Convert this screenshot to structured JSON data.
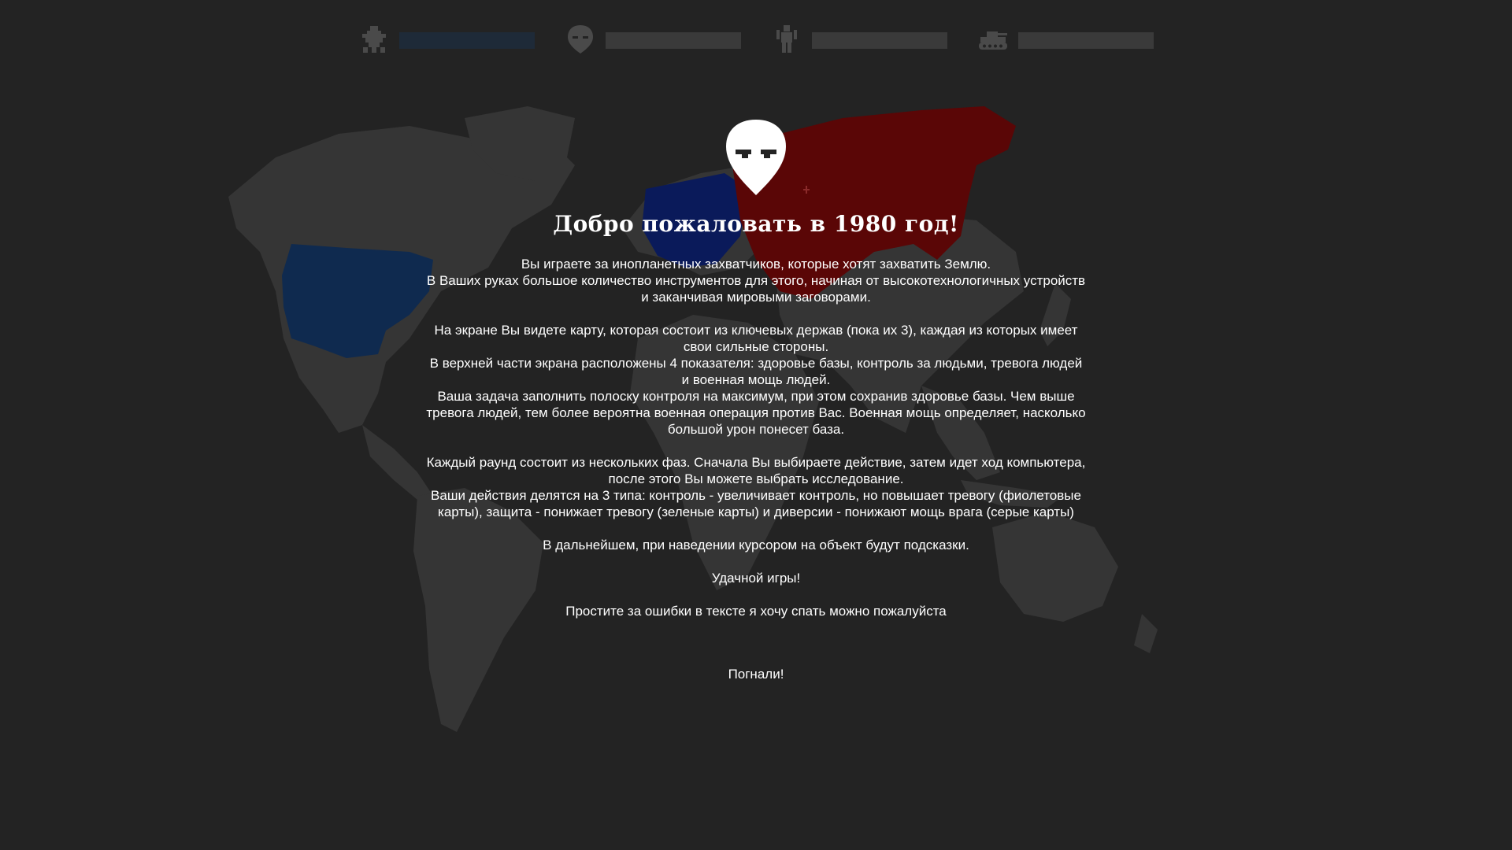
{
  "indicators": [
    {
      "id": "base_health",
      "icon": "base-icon",
      "value": 1.0,
      "color": "#1e2a38"
    },
    {
      "id": "control",
      "icon": "alien-icon",
      "value": 0.0,
      "color": "#6a3f8a"
    },
    {
      "id": "alarm",
      "icon": "human-icon",
      "value": 0.0,
      "color": "#3f8a4f"
    },
    {
      "id": "military",
      "icon": "tank-icon",
      "value": 0.0,
      "color": "#8a3f3f"
    }
  ],
  "colors": {
    "background": "#232323",
    "land": "#3a3a3a",
    "usa": "#0f2a4f",
    "europe": "#0a1a5a",
    "ussr": "#5a0606",
    "text": "#ffffff"
  },
  "intro": {
    "logo_icon": "alien-head-icon",
    "title": "Добро пожаловать в 1980 год!",
    "paragraphs": [
      [
        "Вы играете за инопланетных захватчиков, которые хотят захватить Землю.",
        "В Ваших руках большое количество инструментов для этого, начиная от высокотехнологичных устройств и заканчивая мировыми заговорами."
      ],
      [
        "На экране Вы видете карту, которая состоит из ключевых держав (пока их 3), каждая из которых имеет свои сильные стороны.",
        "В верхней части экрана расположены 4 показателя: здоровье базы, контроль за людьми, тревога людей и военная мощь людей.",
        "Ваша задача заполнить полоску контроля на максимум, при этом сохранив здоровье базы. Чем выше тревога людей, тем более вероятна военная операция против Вас. Военная мощь определяет, насколько большой урон понесет база."
      ],
      [
        "Каждый раунд состоит из нескольких фаз. Сначала Вы выбираете действие, затем идет ход компьютера, после этого Вы можете выбрать исследование.",
        "Ваши действия делятся на 3 типа: контроль - увеличивает контроль, но повышает тревогу (фиолетовые карты), защита - понижает тревогу (зеленые карты) и диверсии - понижают мощь врага (серые карты)"
      ],
      [
        "В дальнейшем, при наведении курсором на объект будут подсказки."
      ],
      [
        "Удачной игры!"
      ],
      [
        "Простите за ошибки в тексте я хочу спать можно пожалуйста"
      ]
    ],
    "start_label": "Погнали!"
  }
}
